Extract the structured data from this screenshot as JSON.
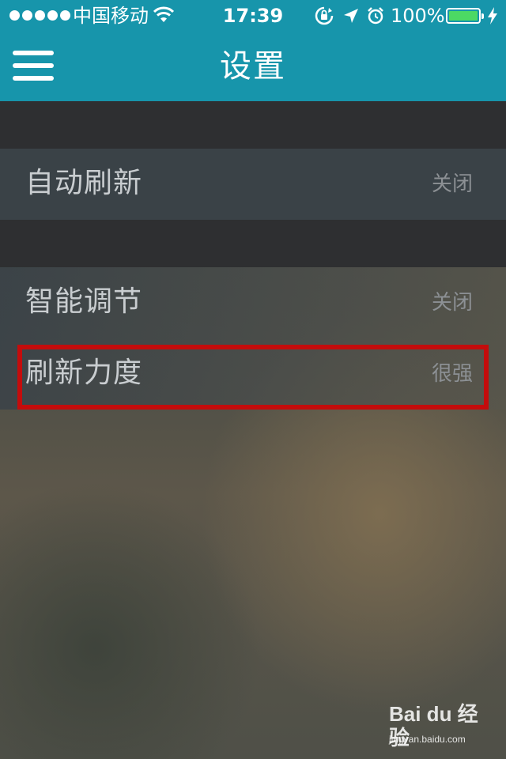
{
  "status_bar": {
    "carrier": "中国移动",
    "time": "17:39",
    "battery_percent": "100%",
    "icons": [
      "signal-dots-icon",
      "wifi-icon",
      "rotation-lock-icon",
      "location-arrow-icon",
      "alarm-icon",
      "battery-icon",
      "charging-bolt-icon"
    ],
    "battery_color": "#4cd964"
  },
  "nav": {
    "title": "设置",
    "menu_icon": "hamburger-menu-icon",
    "bar_color": "#1795ab"
  },
  "settings": {
    "items": [
      {
        "label": "自动刷新",
        "value": "关闭"
      },
      {
        "label": "智能调节",
        "value": "关闭"
      },
      {
        "label": "刷新力度",
        "value": "很强"
      }
    ],
    "highlight_color": "#c40c0c"
  },
  "watermark": {
    "logo": "Bai du 经验",
    "url": "jingyan.baidu.com"
  }
}
